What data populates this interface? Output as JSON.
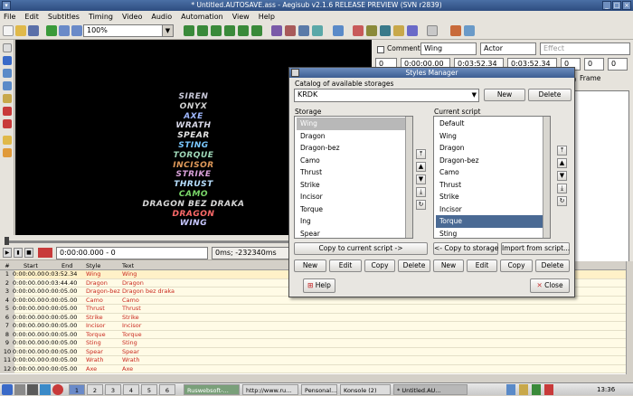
{
  "window": {
    "title": "* Untitled.AUTOSAVE.ass - Aegisub v2.1.6 RELEASE PREVIEW (SVN r2839)"
  },
  "menu": [
    "File",
    "Edit",
    "Subtitles",
    "Timing",
    "Video",
    "Audio",
    "Automation",
    "View",
    "Help"
  ],
  "toolbar": {
    "zoom": "100%"
  },
  "video_lines": [
    {
      "text": "SIREN",
      "color": "#c8c8d8"
    },
    {
      "text": "ONYX",
      "color": "#d0d0d0"
    },
    {
      "text": "AXE",
      "color": "#9fb8ff"
    },
    {
      "text": "WRATH",
      "color": "#d8d8e8"
    },
    {
      "text": "SPEAR",
      "color": "#e6e6e6"
    },
    {
      "text": "STING",
      "color": "#7ac8ff"
    },
    {
      "text": "TORQUE",
      "color": "#9fd8b8"
    },
    {
      "text": "INCISOR",
      "color": "#e09a5a"
    },
    {
      "text": "STRIKE",
      "color": "#d8a0d8"
    },
    {
      "text": "THRUST",
      "color": "#b8e0ff"
    },
    {
      "text": "CAMO",
      "color": "#7ad86a"
    },
    {
      "text": "DRAGON BEZ DRAKA",
      "color": "#d8d8d8"
    },
    {
      "text": "DRAGON",
      "color": "#ff6a6a"
    },
    {
      "text": "WING",
      "color": "#c8c8ff"
    }
  ],
  "edit": {
    "comment_label": "Comment",
    "style": "Wing",
    "actor": "Actor",
    "effect_placeholder": "Effect",
    "layer": "0",
    "start": "0:00:00.00",
    "end": "0:03:52.34",
    "duration": "0:03:52.34",
    "margins": [
      "0",
      "0",
      "0"
    ],
    "frame_label": "Frame"
  },
  "controls": {
    "time": "0:00:00.000 - 0",
    "ms": "0ms; -232340ms"
  },
  "grid": {
    "columns": [
      "#",
      "Start",
      "End",
      "Style",
      "Text"
    ],
    "rows": [
      [
        "1",
        "0:00:00.00",
        "0:03:52.34",
        "Wing",
        "Wing"
      ],
      [
        "2",
        "0:00:00.00",
        "0:03:44.40",
        "Dragon",
        "Dragon"
      ],
      [
        "3",
        "0:00:00.00",
        "0:00:05.00",
        "Dragon-bez",
        "Dragon bez draka"
      ],
      [
        "4",
        "0:00:00.00",
        "0:00:05.00",
        "Camo",
        "Camo"
      ],
      [
        "5",
        "0:00:00.00",
        "0:00:05.00",
        "Thrust",
        "Thrust"
      ],
      [
        "6",
        "0:00:00.00",
        "0:00:05.00",
        "Strike",
        "Strike"
      ],
      [
        "7",
        "0:00:00.00",
        "0:00:05.00",
        "Incisor",
        "Incisor"
      ],
      [
        "8",
        "0:00:00.00",
        "0:00:05.00",
        "Torque",
        "Torque"
      ],
      [
        "9",
        "0:00:00.00",
        "0:00:05.00",
        "Sting",
        "Sting"
      ],
      [
        "10",
        "0:00:00.00",
        "0:00:05.00",
        "Spear",
        "Spear"
      ],
      [
        "11",
        "0:00:00.00",
        "0:00:05.00",
        "Wrath",
        "Wrath"
      ],
      [
        "12",
        "0:00:00.00",
        "0:00:05.00",
        "Axe",
        "Axe"
      ]
    ]
  },
  "dialog": {
    "title": "Styles Manager",
    "catalog_label": "Catalog of available storages",
    "catalog_value": "KRDK",
    "new": "New",
    "delete": "Delete",
    "storage_label": "Storage",
    "current_label": "Current script",
    "storage_items": [
      "Wing",
      "Dragon",
      "Dragon-bez",
      "Camo",
      "Thrust",
      "Strike",
      "Incisor",
      "Torque",
      "Ing",
      "Spear"
    ],
    "current_items": [
      "Default",
      "Wing",
      "Dragon",
      "Dragon-bez",
      "Camo",
      "Thrust",
      "Strike",
      "Incisor",
      "Torque",
      "Sting"
    ],
    "copy_to_current": "Copy to current script ->",
    "copy_to_storage": "<- Copy to storage",
    "import": "Import from script...",
    "edit": "Edit",
    "copy": "Copy",
    "help": "Help",
    "close": "Close"
  },
  "taskbar": {
    "desktops": [
      "1",
      "2",
      "3",
      "4",
      "5",
      "6"
    ],
    "tasks": [
      "Ruswebsoft-...",
      "http://www.ru...",
      "Pensonal...",
      "Konsole (2)",
      "* Untitled.AU..."
    ],
    "clock": "13:36"
  },
  "colors": {
    "accent": "#4a6a94",
    "titlebar": "#3d5e92",
    "grid_row": "#fffbe6"
  }
}
